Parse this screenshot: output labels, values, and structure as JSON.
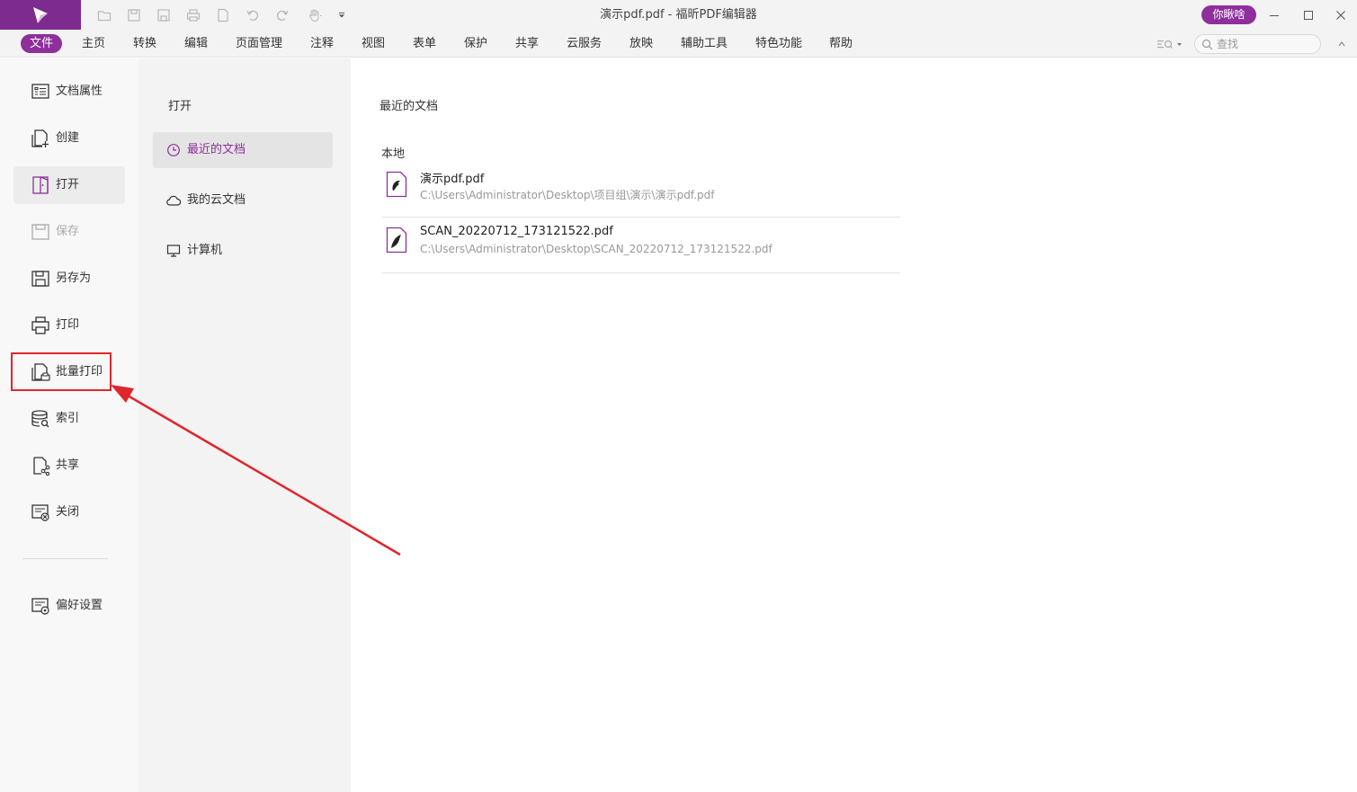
{
  "window": {
    "title": "演示pdf.pdf - 福昕PDF编辑器",
    "user_button": "你瞅啥"
  },
  "icons": {
    "logo": "foxit-logo-icon",
    "quick_access": [
      "open-folder-icon",
      "save-icon",
      "save-as-icon",
      "print-icon",
      "new-icon",
      "undo-icon",
      "redo-icon",
      "hand-tool-icon",
      "customize-dropdown-icon"
    ],
    "window_controls": [
      "minimize-icon",
      "maximize-icon",
      "close-icon"
    ]
  },
  "menubar": {
    "tabs": [
      "文件",
      "主页",
      "转换",
      "编辑",
      "页面管理",
      "注释",
      "视图",
      "表单",
      "保护",
      "共享",
      "云服务",
      "放映",
      "辅助工具",
      "特色功能",
      "帮助"
    ],
    "active_tab": "文件",
    "search_placeholder": "查找"
  },
  "leftnav": {
    "items": [
      {
        "label": "文档属性",
        "icon": "document-properties-icon"
      },
      {
        "label": "创建",
        "icon": "create-icon"
      },
      {
        "label": "打开",
        "icon": "open-book-icon"
      },
      {
        "label": "保存",
        "icon": "save-icon"
      },
      {
        "label": "另存为",
        "icon": "save-as-icon"
      },
      {
        "label": "打印",
        "icon": "print-icon"
      },
      {
        "label": "批量打印",
        "icon": "batch-print-icon"
      },
      {
        "label": "索引",
        "icon": "index-database-icon"
      },
      {
        "label": "共享",
        "icon": "share-icon"
      },
      {
        "label": "关闭",
        "icon": "close-document-icon"
      },
      {
        "label": "偏好设置",
        "icon": "preferences-icon"
      }
    ],
    "active_item": "打开",
    "disabled_item": "保存",
    "highlighted_item": "批量打印"
  },
  "midpanel": {
    "title": "打开",
    "items": [
      {
        "label": "最近的文档",
        "icon": "clock-icon"
      },
      {
        "label": "我的云文档",
        "icon": "cloud-icon"
      },
      {
        "label": "计算机",
        "icon": "computer-icon"
      }
    ],
    "active_item": "最近的文档"
  },
  "content": {
    "title": "最近的文档",
    "section": "本地",
    "files": [
      {
        "name": "演示pdf.pdf",
        "path": "C:\\Users\\Administrator\\Desktop\\项目组\\演示\\演示pdf.pdf"
      },
      {
        "name": "SCAN_20220712_173121522.pdf",
        "path": "C:\\Users\\Administrator\\Desktop\\SCAN_20220712_173121522.pdf"
      }
    ]
  },
  "colors": {
    "accent": "#8e2f9c",
    "logo_bg": "#7d2b8e",
    "annotation_red": "#e0262b"
  }
}
